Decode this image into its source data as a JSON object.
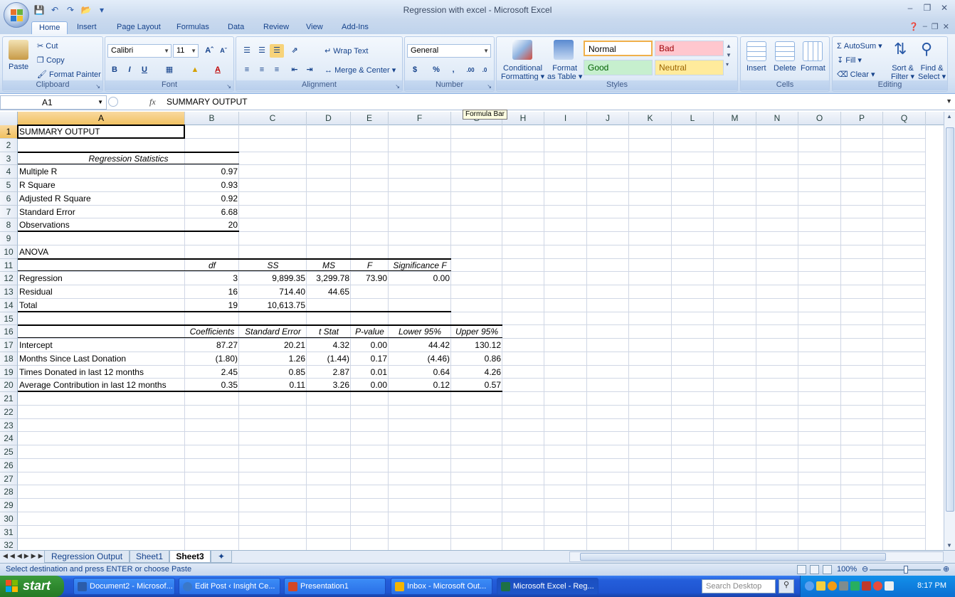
{
  "window": {
    "title": "Regression with excel - Microsoft Excel"
  },
  "ribbon": {
    "tabs": [
      "Home",
      "Insert",
      "Page Layout",
      "Formulas",
      "Data",
      "Review",
      "View",
      "Add-Ins"
    ],
    "clipboard": {
      "label": "Clipboard",
      "paste": "Paste",
      "cut": "Cut",
      "copy": "Copy",
      "format_painter": "Format Painter"
    },
    "font": {
      "label": "Font",
      "name": "Calibri",
      "size": "11",
      "bold": "B",
      "italic": "I",
      "underline": "U"
    },
    "alignment": {
      "label": "Alignment",
      "wrap_text": "Wrap Text",
      "merge_center": "Merge & Center"
    },
    "number": {
      "label": "Number",
      "format": "General",
      "currency": "$",
      "percent": "%",
      "comma": ","
    },
    "styles": {
      "label": "Styles",
      "conditional": "Conditional",
      "formatting": "Formatting",
      "format": "Format",
      "as_table": "as Table",
      "normal": "Normal",
      "bad": "Bad",
      "good": "Good",
      "neutral": "Neutral"
    },
    "cells": {
      "label": "Cells",
      "insert": "Insert",
      "delete": "Delete",
      "format": "Format"
    },
    "editing": {
      "label": "Editing",
      "autosum": "AutoSum",
      "fill": "Fill",
      "clear": "Clear",
      "sort": "Sort &",
      "filter": "Filter",
      "find": "Find &",
      "select": "Select"
    }
  },
  "formula_bar": {
    "name_box": "A1",
    "fx": "fx",
    "value": "SUMMARY OUTPUT",
    "tooltip": "Formula Bar"
  },
  "columns": [
    "A",
    "B",
    "C",
    "D",
    "E",
    "F",
    "G",
    "H",
    "I",
    "J",
    "K",
    "L",
    "M",
    "N",
    "O",
    "P",
    "Q"
  ],
  "rows": [
    "1",
    "2",
    "3",
    "4",
    "5",
    "6",
    "7",
    "8",
    "9",
    "10",
    "11",
    "12",
    "13",
    "14",
    "15",
    "16",
    "17",
    "18",
    "19",
    "20",
    "21",
    "22",
    "23",
    "24",
    "25",
    "26",
    "27",
    "28",
    "29",
    "30",
    "31",
    "32"
  ],
  "sheet": {
    "r1": {
      "a": "SUMMARY OUTPUT"
    },
    "r3": {
      "a": "Regression Statistics"
    },
    "r4": {
      "a": "Multiple R",
      "b": "0.97"
    },
    "r5": {
      "a": "R Square",
      "b": "0.93"
    },
    "r6": {
      "a": "Adjusted R Square",
      "b": "0.92"
    },
    "r7": {
      "a": "Standard Error",
      "b": "6.68"
    },
    "r8": {
      "a": "Observations",
      "b": "20"
    },
    "r10": {
      "a": "ANOVA"
    },
    "r11": {
      "b": "df",
      "c": "SS",
      "d": "MS",
      "e": "F",
      "f": "Significance F"
    },
    "r12": {
      "a": "Regression",
      "b": "3",
      "c": "9,899.35",
      "d": "3,299.78",
      "e": "73.90",
      "f": "0.00"
    },
    "r13": {
      "a": "Residual",
      "b": "16",
      "c": "714.40",
      "d": "44.65"
    },
    "r14": {
      "a": "Total",
      "b": "19",
      "c": "10,613.75"
    },
    "r16": {
      "b": "Coefficients",
      "c": "Standard Error",
      "d": "t Stat",
      "e": "P-value",
      "f": "Lower 95%",
      "g": "Upper 95%"
    },
    "r17": {
      "a": "Intercept",
      "b": "87.27",
      "c": "20.21",
      "d": "4.32",
      "e": "0.00",
      "f": "44.42",
      "g": "130.12"
    },
    "r18": {
      "a": "Months Since Last Donation",
      "b": "(1.80)",
      "c": "1.26",
      "d": "(1.44)",
      "e": "0.17",
      "f": "(4.46)",
      "g": "0.86"
    },
    "r19": {
      "a": "Times Donated in last 12 months",
      "b": "2.45",
      "c": "0.85",
      "d": "2.87",
      "e": "0.01",
      "f": "0.64",
      "g": "4.26"
    },
    "r20": {
      "a": "Average Contribution in last 12 months",
      "b": "0.35",
      "c": "0.11",
      "d": "3.26",
      "e": "0.00",
      "f": "0.12",
      "g": "0.57"
    }
  },
  "sheet_tabs": [
    "Regression Output",
    "Sheet1",
    "Sheet3"
  ],
  "active_sheet": "Sheet3",
  "status": {
    "message": "Select destination and press ENTER or choose Paste",
    "zoom": "100%"
  },
  "taskbar": {
    "start": "start",
    "buttons": [
      "Document2 - Microsof...",
      "Edit Post ‹ Insight Ce...",
      "Presentation1",
      "Inbox - Microsoft Out...",
      "Microsoft Excel - Reg..."
    ],
    "search_placeholder": "Search Desktop",
    "clock": "8:17 PM"
  }
}
